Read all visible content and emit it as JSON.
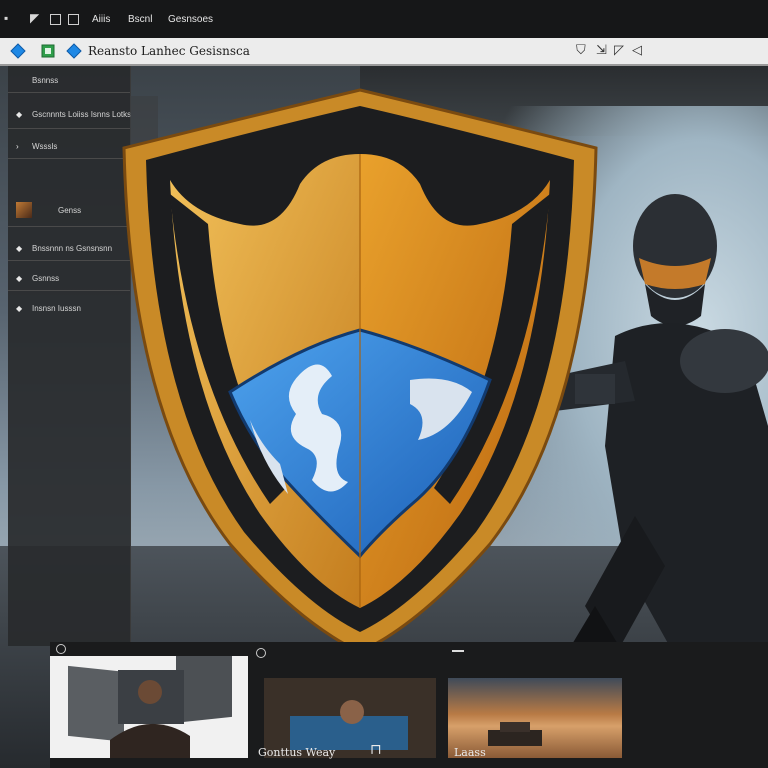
{
  "menubar": {
    "items": [
      "Aiiis",
      "Bscnl",
      "Gesnsoes"
    ]
  },
  "addressbar": {
    "url_text": "Reansto Lanhec Gesisnsca",
    "nav_icons": [
      "shield-icon",
      "share-icon",
      "forward-icon",
      "back-icon"
    ]
  },
  "sidebar": {
    "header": "Bsnnss",
    "items": [
      {
        "label": "Gscnnnts Loiiss Isnns Lotks",
        "icon": "diamond-icon"
      },
      {
        "label": "Wsssls",
        "icon": "chevron-right-icon"
      },
      {
        "label": "Genss",
        "icon": "thumbnail"
      },
      {
        "label": "Bnssnnn ns Gsnsnsnn",
        "icon": "diamond-icon"
      },
      {
        "label": "Gsnnss",
        "icon": "diamond-icon"
      },
      {
        "label": "Insnsn Iusssn",
        "icon": "diamond-icon"
      }
    ]
  },
  "bottom_strip": {
    "card2_title": "Gonttus Weay",
    "card3_title": "Laass"
  },
  "colors": {
    "shield_gold": "#e3a43a",
    "shield_dark": "#1c1d1f",
    "shield_blue": "#2f7fd6",
    "accent_blue": "#1e88e5",
    "accent_green": "#2e9e4a"
  }
}
